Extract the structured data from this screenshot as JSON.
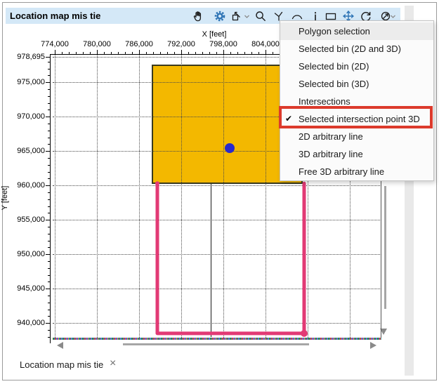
{
  "window": {
    "title": "Location map mis tie",
    "titlebar_color": "#D4E8F7"
  },
  "toolbar": {
    "icons": [
      "pan-hand",
      "settings-gear",
      "fit-view",
      "dropdown-chevron",
      "zoom-magnifier",
      "pick-fork",
      "arc-line",
      "info",
      "rectangle-select",
      "move-arrows",
      "rotate",
      "measure-circle",
      "dropdown-chevron"
    ]
  },
  "menu": {
    "annotation_color": "#DC3A2C",
    "items": [
      {
        "label": "Polygon selection",
        "hovered": true
      },
      {
        "label": "Selected bin (2D and 3D)"
      },
      {
        "label": "Selected bin (2D)"
      },
      {
        "label": "Selected bin (3D)"
      },
      {
        "label": "Intersections"
      },
      {
        "label": "Selected intersection point 3D",
        "checked": true,
        "annotated": true
      },
      {
        "label": "2D arbitrary line"
      },
      {
        "label": "3D arbitrary line"
      },
      {
        "label": "Free 3D arbitrary line"
      }
    ]
  },
  "tab": {
    "label": "Location map mis tie",
    "close_glyph": "×"
  },
  "chart_data": {
    "type": "scatter",
    "title": "",
    "xlabel": "X [feet]",
    "ylabel": "Y [feet]",
    "xlim": [
      773700,
      820500
    ],
    "ylim": [
      937673,
      979000
    ],
    "x_tick_values": [
      774000,
      780000,
      786000,
      792000,
      798000,
      804000
    ],
    "x_tick_labels": [
      "774,000",
      "780,000",
      "786,000",
      "792,000",
      "798,000",
      "804,000"
    ],
    "x_gridline_values": [
      774000,
      780000,
      786000,
      792000,
      798000,
      804000,
      810000,
      816000
    ],
    "y_tick_values": [
      978695,
      975000,
      970000,
      965000,
      960000,
      955000,
      950000,
      945000,
      940000
    ],
    "y_tick_labels": [
      "978,695",
      "975,000",
      "970,000",
      "965,000",
      "960,000",
      "955,000",
      "950,000",
      "945,000",
      "940,000"
    ],
    "minor_tick_step": 1000,
    "grid": "dotted",
    "shapes": {
      "survey_area_3d": {
        "type": "polygon",
        "fill": "#F3B800",
        "outline": "#3a3a1e",
        "x": [
          787800,
          809300
        ],
        "y": [
          960200,
          977600
        ]
      },
      "selected_intersection_point": {
        "type": "point",
        "color": "#2929CC",
        "x": 798900,
        "y": 965400
      },
      "arbitrary_line_selection": {
        "type": "polyline",
        "color": "#E23A75",
        "width": 5,
        "points": [
          [
            788600,
            960300
          ],
          [
            788600,
            938500
          ],
          [
            809500,
            938500
          ],
          [
            809500,
            960300
          ]
        ]
      },
      "line_2d": {
        "type": "vline",
        "color": "#1a1a1a",
        "x": 796200,
        "y": [
          937950,
          960200
        ]
      }
    }
  }
}
